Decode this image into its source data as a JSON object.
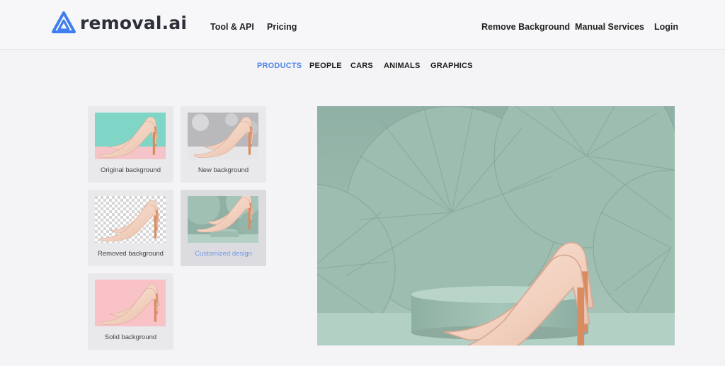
{
  "header": {
    "logo_text": "removal.ai",
    "left_nav": [
      "Tool & API",
      "Pricing"
    ],
    "right_nav": [
      "Remove Background",
      "Manual Services",
      "Login"
    ]
  },
  "tabs": [
    {
      "label": "PRODUCTS",
      "active": true
    },
    {
      "label": "PEOPLE",
      "active": false
    },
    {
      "label": "CARS",
      "active": false
    },
    {
      "label": "ANIMALS",
      "active": false
    },
    {
      "label": "GRAPHICS",
      "active": false
    }
  ],
  "cards": [
    {
      "label": "Original background",
      "background": "mint-pink"
    },
    {
      "label": "New background",
      "background": "gray-bokeh"
    },
    {
      "label": "Removed background",
      "background": "transparent-checker"
    },
    {
      "label": "Customized design",
      "background": "sage-fans",
      "selected": true
    },
    {
      "label": "Solid background",
      "background": "pink"
    }
  ],
  "preview": {
    "subject": "pair-of-nude-high-heels",
    "background": "sage-green-paper-fans"
  },
  "colors": {
    "accent": "#4f86e8",
    "logo_blue": "#3f7ef0",
    "page_bg": "#f4f4f6",
    "card_bg": "#e9e9ec",
    "sage": "#9cb8ac",
    "pink": "#f8c2c6",
    "mint": "#7fd6c6"
  }
}
